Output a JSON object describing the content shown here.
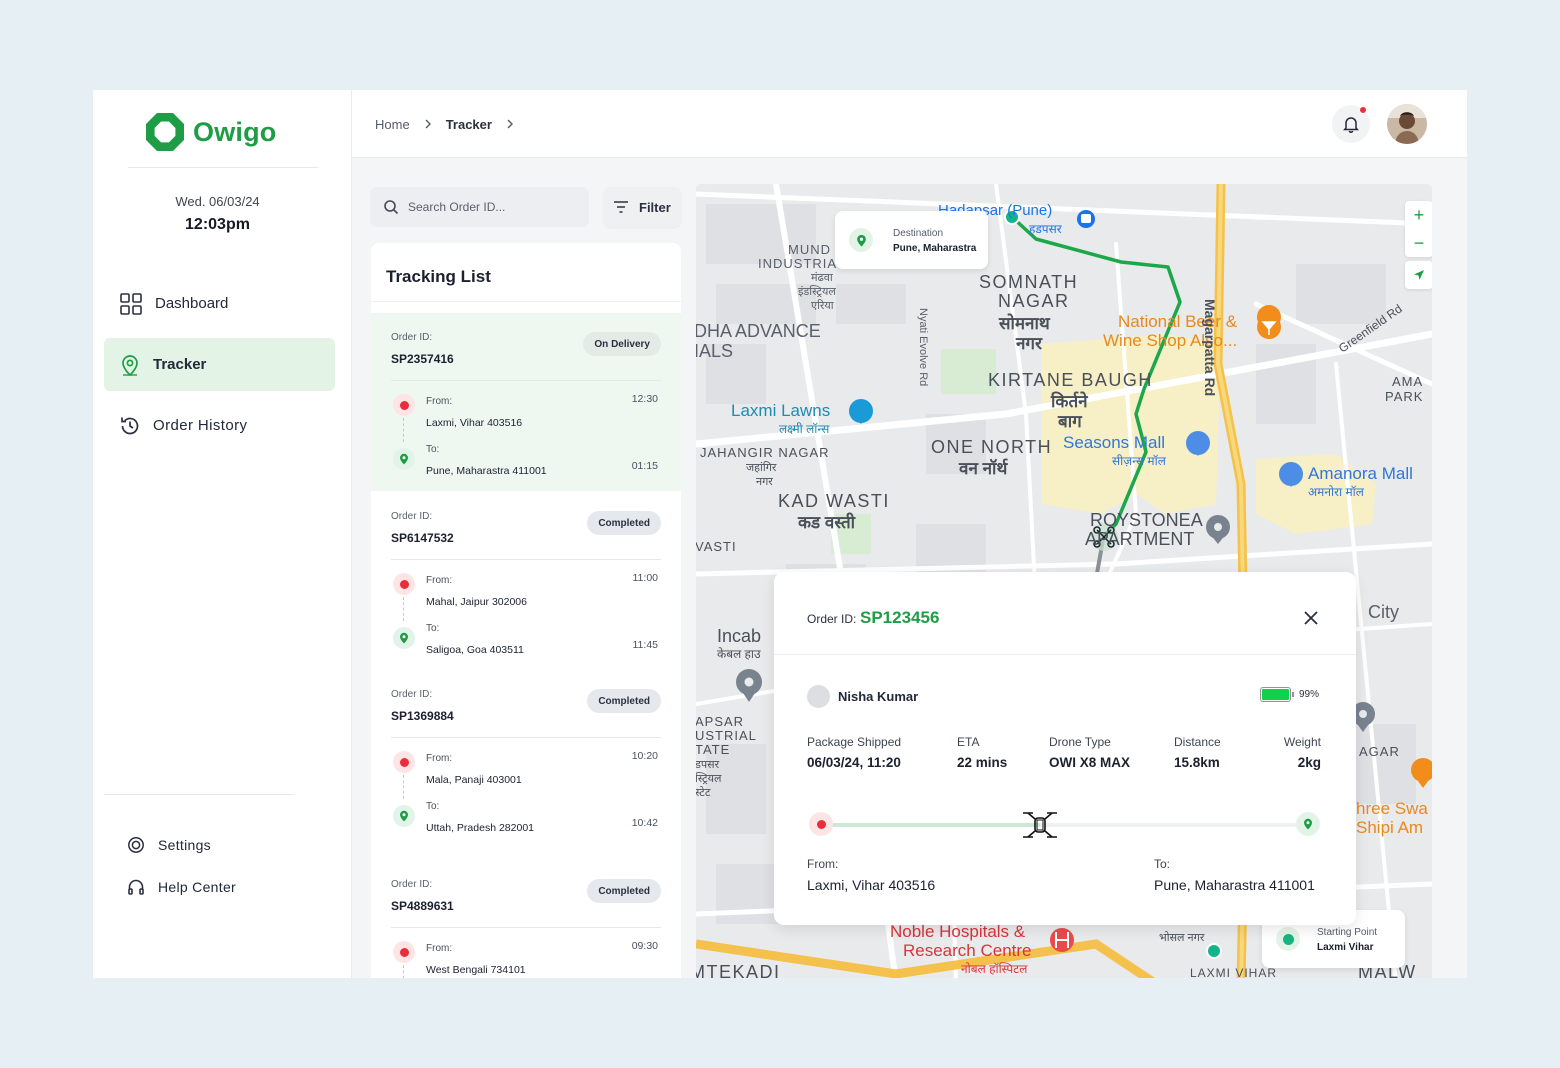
{
  "app": {
    "brand": "Owigo",
    "brand_color": "#1f9d46"
  },
  "sidebar": {
    "date": "Wed. 06/03/24",
    "time": "12:03pm",
    "nav": [
      {
        "label": "Dashboard",
        "icon": "grid-icon",
        "active": false
      },
      {
        "label": "Tracker",
        "icon": "location-pin-icon",
        "active": true
      },
      {
        "label": "Order History",
        "icon": "history-icon",
        "active": false
      }
    ],
    "footer": [
      {
        "label": "Settings",
        "icon": "gear-icon"
      },
      {
        "label": "Help Center",
        "icon": "headset-icon"
      }
    ]
  },
  "header": {
    "breadcrumb": [
      "Home",
      "Tracker"
    ],
    "notification_dot": true
  },
  "search": {
    "placeholder": "Search Order ID...",
    "filter_label": "Filter"
  },
  "tracking_list": {
    "title": "Tracking List",
    "order_id_label": "Order ID:",
    "from_label": "From:",
    "to_label": "To:",
    "orders": [
      {
        "id": "SP2357416",
        "status": "On Delivery",
        "from": "Laxmi, Vihar 403516",
        "from_time": "12:30",
        "to": "Pune, Maharastra 411001",
        "to_time": "01:15",
        "active": true
      },
      {
        "id": "SP6147532",
        "status": "Completed",
        "from": "Mahal, Jaipur 302006",
        "from_time": "11:00",
        "to": "Saligoa, Goa 403511",
        "to_time": "11:45"
      },
      {
        "id": "SP1369884",
        "status": "Completed",
        "from": "Mala, Panaji 403001",
        "from_time": "10:20",
        "to": "Uttah, Pradesh 282001",
        "to_time": "10:42"
      },
      {
        "id": "SP4889631",
        "status": "Completed",
        "from": "West Bengali 734101",
        "from_time": "09:30"
      }
    ]
  },
  "map": {
    "destination": {
      "label": "Destination",
      "value": "Pune, Maharastra"
    },
    "starting_point": {
      "label": "Starting Point",
      "value": "Laxmi Vihar"
    },
    "labels": {
      "hadapsar": "Hadapsar (Pune)",
      "hadapsar_hi": "हडपसर",
      "mund1": "MUND",
      "mund2": "INDUSTRIA",
      "mund_hi1": "मंढवा",
      "mund_hi2": "इंडस्ट्रियल",
      "mund_hi3": "एरिया",
      "somnath1": "SOMNATH",
      "somnath2": "NAGAR",
      "somnath_hi1": "सोमनाथ",
      "somnath_hi2": "नगर",
      "nationalbeer1": "National Beer &",
      "nationalbeer2": "Wine Shop Also...",
      "magarpatta_rd": "Magarpatta Rd",
      "greenfield_rd": "Greenfield Rd",
      "ama1": "AMA",
      "ama2": "PARK",
      "dha1": "DHA ADVANCE",
      "dha2": "IALS",
      "nyati": "Nyati Evolve Rd",
      "kirtane1": "KIRTANE BAUGH",
      "kirtane_hi1": "किर्तने",
      "kirtane_hi2": "बाग",
      "laxmilawns": "Laxmi Lawns",
      "laxmilawns_hi": "लक्ष्मी लॉन्स",
      "jahangir": "JAHANGIR NAGAR",
      "jahangir_hi1": "जहांगिर",
      "jahangir_hi2": "नगर",
      "onenorth": "ONE NORTH",
      "onenorth_hi": "वन नॉर्थ",
      "seasons": "Seasons Mall",
      "seasons_hi": "सीज़न्स मॉल",
      "amanora": "Amanora Mall",
      "amanora_hi": "अमनोरा मॉल",
      "kadwasti": "KAD WASTI",
      "kadwasti_hi": "कड वस्ती",
      "vasti": "VASTI",
      "roystonea1": "ROYSTONEA",
      "roystonea2": "APARTMENT",
      "incab": "Incab",
      "incab_hi": "केबल हाउ",
      "apsar1": "APSAR",
      "apsar2": "USTRIAL",
      "apsar3": "TATE",
      "apsar_hi1": "डपसर",
      "apsar_hi2": "स्ट्रियल",
      "apsar_hi3": "स्टेट",
      "city": "City",
      "agar": "AGAR",
      "shree1": "hree Swa",
      "shree2": "Shipi Am",
      "noble1": "Noble Hospitals &",
      "noble2": "Research Centre",
      "noble_hi": "नोबल हॉस्पिटल",
      "bhosale_hi": "भोसल नगर",
      "laxmivihar": "LAXMI VIHAR",
      "tekadi": "MTEKADI",
      "malw": "MALW"
    }
  },
  "detail": {
    "order_id_label": "Order ID:",
    "order_id": "SP123456",
    "customer": "Nisha Kumar",
    "battery_pct": 99,
    "battery_text": "99%",
    "stats": [
      {
        "label": "Package Shipped",
        "value": "06/03/24, 11:20"
      },
      {
        "label": "ETA",
        "value": "22 mins"
      },
      {
        "label": "Drone Type",
        "value": "OWI X8 MAX"
      },
      {
        "label": "Distance",
        "value": "15.8km"
      },
      {
        "label": "Weight",
        "value": "2kg"
      }
    ],
    "progress": 0.44,
    "from_label": "From:",
    "from": "Laxmi, Vihar 403516",
    "to_label": "To:",
    "to": "Pune, Maharastra 411001"
  }
}
